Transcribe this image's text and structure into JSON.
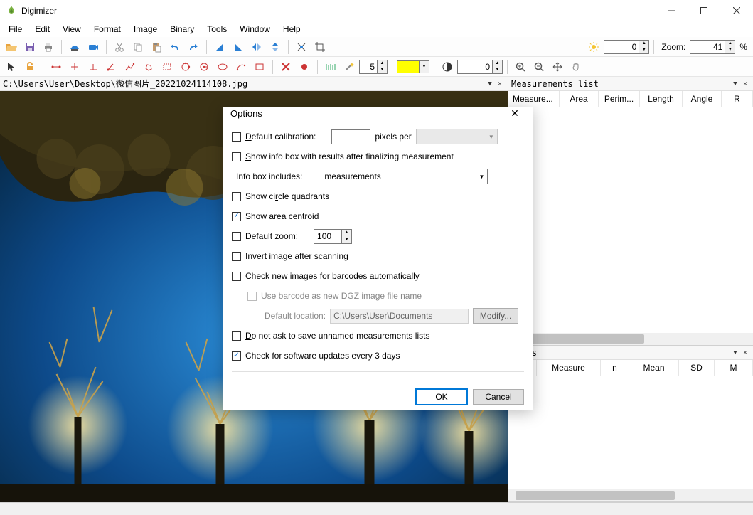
{
  "app": {
    "title": "Digimizer"
  },
  "menu": {
    "items": [
      "File",
      "Edit",
      "View",
      "Format",
      "Image",
      "Binary",
      "Tools",
      "Window",
      "Help"
    ]
  },
  "toolbar": {
    "brightness_value": "0",
    "contrast_value": "0",
    "zoom_label": "Zoom:",
    "zoom_value": "41",
    "zoom_unit": "%",
    "length_value": "5"
  },
  "image_pane": {
    "path": "C:\\Users\\User\\Desktop\\微信图片_20221024114108.jpg"
  },
  "measurements_panel": {
    "title": "Measurements list",
    "columns": [
      "Measure...",
      "Area",
      "Perim...",
      "Length",
      "Angle",
      "R"
    ]
  },
  "stats_panel": {
    "title": "stics",
    "columns": [
      "",
      "Measure",
      "n",
      "Mean",
      "SD",
      "M"
    ]
  },
  "dialog": {
    "title": "Options",
    "default_calibration_label": "Default calibration:",
    "pixels_per_label": "pixels per",
    "show_infobox_label": "Show info box with results after finalizing measurement",
    "infobox_includes_label": "Info box includes:",
    "infobox_value": "measurements",
    "show_circle_quadrants": "Show circle quadrants",
    "show_area_centroid": "Show area centroid",
    "default_zoom_label": "Default zoom:",
    "default_zoom_value": "100",
    "invert_label": "Invert image after scanning",
    "check_barcodes_label": "Check new images for barcodes automatically",
    "use_barcode_label": "Use barcode as new DGZ image file name",
    "default_location_label": "Default location:",
    "default_location_value": "C:\\Users\\User\\Documents",
    "modify_label": "Modify...",
    "donot_ask_label": "Do not ask to save unnamed measurements lists",
    "check_updates_label": "Check for software updates every 3 days",
    "ok": "OK",
    "cancel": "Cancel"
  }
}
